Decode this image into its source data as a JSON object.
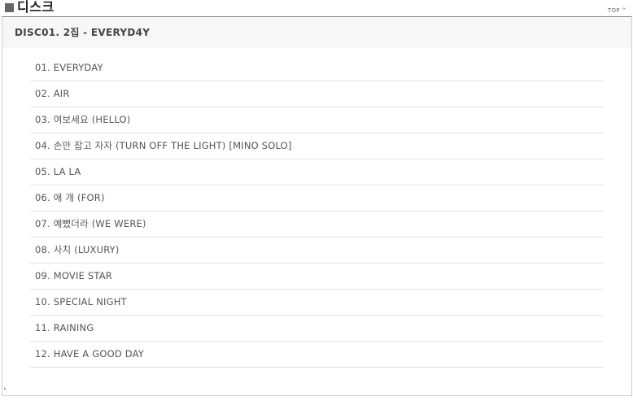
{
  "section": {
    "title": "디스크",
    "top_link": "TOP"
  },
  "disc": {
    "title": "DISC01. 2집 - EVERYD4Y",
    "tracks": [
      {
        "label": "01. EVERYDAY"
      },
      {
        "label": "02. AIR"
      },
      {
        "label": "03. 여보세요 (HELLO)"
      },
      {
        "label": "04. 손만 잡고 자자 (TURN OFF THE LIGHT) [MINO SOLO]"
      },
      {
        "label": "05. LA LA"
      },
      {
        "label": "06. 애 개 (FOR)"
      },
      {
        "label": "07. 예뻤더라 (WE WERE)"
      },
      {
        "label": "08. 사치 (LUXURY)"
      },
      {
        "label": "09. MOVIE STAR"
      },
      {
        "label": "10. SPECIAL NIGHT"
      },
      {
        "label": "11. RAINING"
      },
      {
        "label": "12. HAVE A GOOD DAY"
      }
    ]
  },
  "icons": {
    "title_marker": "square-bullet-icon",
    "top_caret": "chevron-up-icon"
  }
}
